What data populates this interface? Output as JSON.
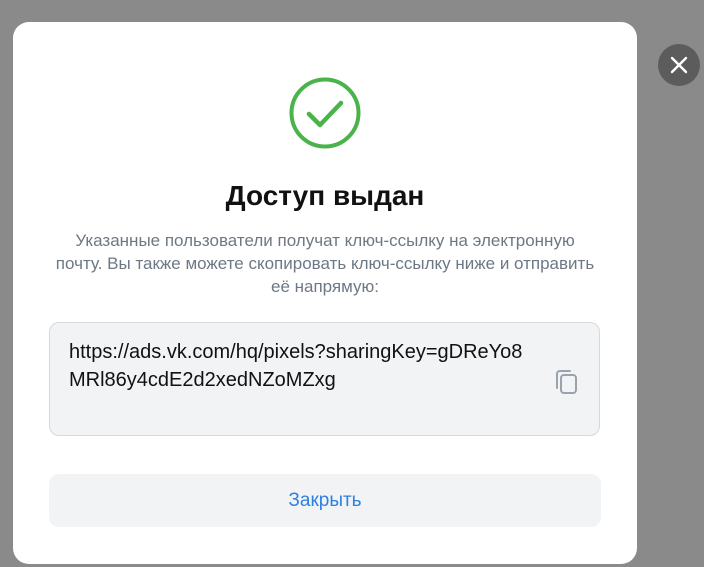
{
  "dialog": {
    "title": "Доступ выдан",
    "description": "Указанные пользователи получат ключ-ссылку на электронную почту. Вы также можете скопировать ключ-ссылку ниже и отправить её напрямую:",
    "link": "https://ads.vk.com/hq/pixels?sharingKey=gDReYo8MRl86y4cdE2d2xedNZoMZxg",
    "close_button_label": "Закрыть"
  },
  "icons": {
    "success": "check-circle-icon",
    "copy": "copy-icon",
    "dismiss": "close-icon"
  },
  "colors": {
    "success": "#4bb34b",
    "accent": "#2d81e0",
    "backdrop": "#8a8a8a"
  }
}
